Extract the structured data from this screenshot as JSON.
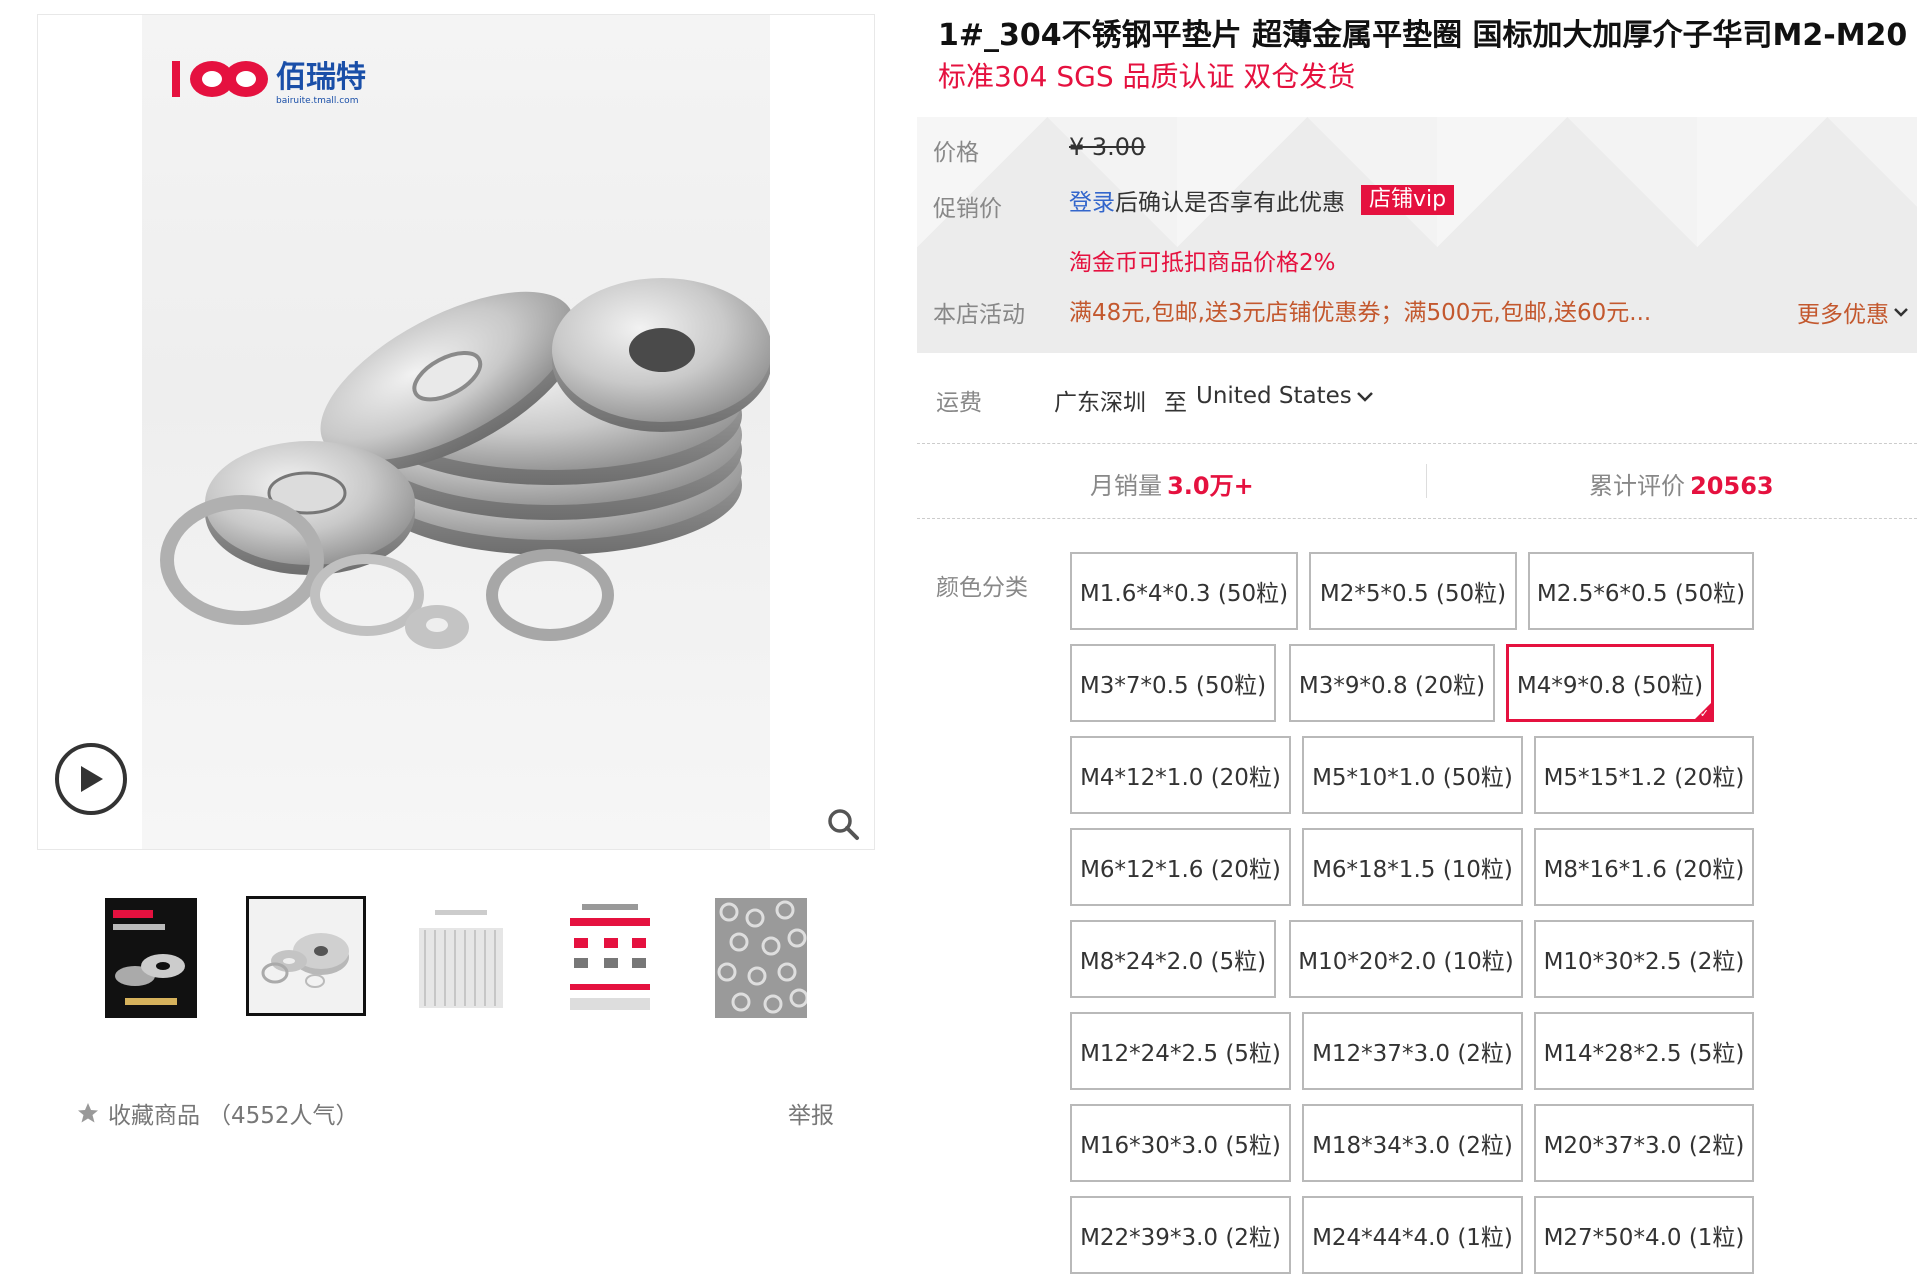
{
  "gallery": {
    "brand_name": "佰瑞特",
    "brand_url": "bairuite.tmall.com",
    "thumbnail_count": 5,
    "active_thumbnail": 2
  },
  "product": {
    "title": "1#_304不锈钢平垫片 超薄金属平垫圈 国标加大加厚介子华司M2-M20",
    "subtitle": "标准304 SGS 品质认证 双仓发货"
  },
  "price_panel": {
    "price_label": "价格",
    "price_value": "¥ 3.00",
    "promo_label": "促销价",
    "login_link": "登录",
    "login_text": "后确认是否享有此优惠",
    "vip_badge": "店铺vip",
    "coin_text": "淘金币可抵扣商品价格2%",
    "activity_label": "本店活动",
    "activity_text": "满48元,包邮,送3元店铺优惠券；满500元,包邮,送60元...",
    "more_deals": "更多优惠"
  },
  "shipping": {
    "label": "运费",
    "from": "广东深圳",
    "to_prefix": "至",
    "destination": "United States"
  },
  "stats": {
    "monthly_sales_label": "月销量",
    "monthly_sales_value": "3.0万+",
    "reviews_label": "累计评价",
    "reviews_value": "20563"
  },
  "sku": {
    "label": "颜色分类",
    "selected": "M4*9*0.8 (50粒)",
    "options": [
      "M1.6*4*0.3 (50粒)",
      "M2*5*0.5 (50粒)",
      "M2.5*6*0.5 (50粒)",
      "M3*7*0.5 (50粒)",
      "M3*9*0.8 (20粒)",
      "M4*9*0.8 (50粒)",
      "M4*12*1.0 (20粒)",
      "M5*10*1.0 (50粒)",
      "M5*15*1.2 (20粒)",
      "M6*12*1.6 (20粒)",
      "M6*18*1.5 (10粒)",
      "M8*16*1.6 (20粒)",
      "M8*24*2.0 (5粒)",
      "M10*20*2.0 (10粒)",
      "M10*30*2.5 (2粒)",
      "M12*24*2.5 (5粒)",
      "M12*37*3.0 (2粒)",
      "M14*28*2.5 (5粒)",
      "M16*30*3.0 (5粒)",
      "M18*34*3.0 (2粒)",
      "M20*37*3.0 (2粒)",
      "M22*39*3.0 (2粒)",
      "M24*44*4.0 (1粒)",
      "M27*50*4.0 (1粒)"
    ]
  },
  "footer": {
    "favorite_label": "收藏商品",
    "favorite_count": "（4552人气）",
    "report_label": "举报"
  },
  "colors": {
    "accent": "#e5113f",
    "link": "#3366cc",
    "promo": "#c3582e"
  }
}
